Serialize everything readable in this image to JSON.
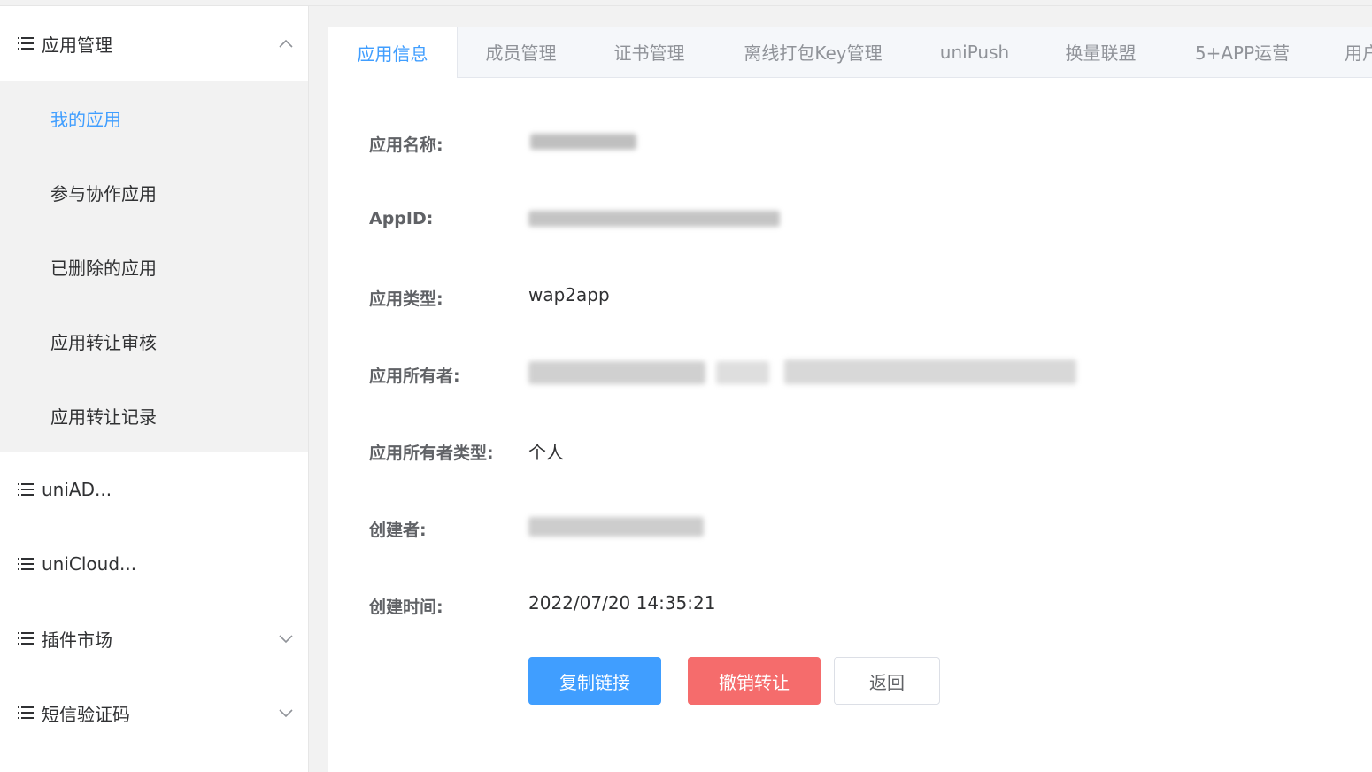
{
  "sidebar": {
    "groups": [
      {
        "label": "应用管理",
        "icon": "list-icon",
        "chevron": "chevron-up-icon"
      },
      {
        "label": "uniAD...",
        "icon": "list-icon"
      },
      {
        "label": "uniCloud...",
        "icon": "list-icon"
      },
      {
        "label": "插件市场",
        "icon": "list-icon",
        "chevron": "chevron-down-icon"
      },
      {
        "label": "短信验证码",
        "icon": "list-icon",
        "chevron": "chevron-down-icon"
      }
    ],
    "app_submenu": [
      {
        "label": "我的应用",
        "active": true
      },
      {
        "label": "参与协作应用"
      },
      {
        "label": "已删除的应用"
      },
      {
        "label": "应用转让审核"
      },
      {
        "label": "应用转让记录"
      }
    ]
  },
  "tabs": [
    {
      "label": "应用信息",
      "active": true
    },
    {
      "label": "成员管理"
    },
    {
      "label": "证书管理"
    },
    {
      "label": "离线打包Key管理"
    },
    {
      "label": "uniPush"
    },
    {
      "label": "换量联盟"
    },
    {
      "label": "5+APP运营"
    },
    {
      "label": "用户"
    }
  ],
  "info": {
    "app_name_label": "应用名称:",
    "appid_label": "AppID:",
    "app_type_label": "应用类型:",
    "app_type_value": "wap2app",
    "owner_label": "应用所有者:",
    "owner_type_label": "应用所有者类型:",
    "owner_type_value": "个人",
    "creator_label": "创建者:",
    "created_time_label": "创建时间:",
    "created_time_value": "2022/07/20 14:35:21"
  },
  "buttons": {
    "copy_link": "复制链接",
    "cancel_transfer": "撤销转让",
    "back": "返回"
  },
  "colors": {
    "accent": "#409eff",
    "danger": "#f56c6c",
    "submenu_bg": "#f2f2f2"
  }
}
